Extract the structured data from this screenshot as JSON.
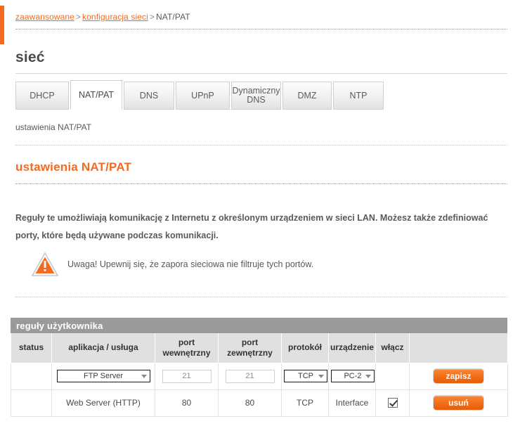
{
  "breadcrumb": {
    "item1": "zaawansowane",
    "sep1": ">",
    "item2": "konfiguracja sieci",
    "sep2": ">",
    "current": "NAT/PAT"
  },
  "page_title": "sieć",
  "tabs": [
    {
      "label": "DHCP",
      "active": false
    },
    {
      "label": "NAT/PAT",
      "active": true
    },
    {
      "label": "DNS",
      "active": false
    },
    {
      "label": "UPnP",
      "active": false
    },
    {
      "label": "Dynamiczny DNS",
      "active": false
    },
    {
      "label": "DMZ",
      "active": false
    },
    {
      "label": "NTP",
      "active": false
    }
  ],
  "sub_label": "ustawienia NAT/PAT",
  "section_heading": "ustawienia NAT/PAT",
  "description": "Reguły te umożliwiają komunikację z Internetu z określonym urządzeniem w sieci LAN. Możesz także zdefiniować porty, które będą używane podczas komunikacji.",
  "warning": {
    "icon": "warning-triangle-icon",
    "text": "Uwaga! Upewnij się, że zapora sieciowa nie filtruje tych portów."
  },
  "table": {
    "caption": "reguły użytkownika",
    "headers": {
      "status": "status",
      "app": "aplikacja / usługa",
      "port_internal": "port wewnętrzny",
      "port_external": "port zewnętrzny",
      "protocol": "protokół",
      "device": "urządzenie",
      "enable": "włącz",
      "action": ""
    },
    "form_row": {
      "status": "",
      "app_value": "FTP Server",
      "app_options": [
        "FTP Server"
      ],
      "port_internal_value": "21",
      "port_external_value": "21",
      "protocol_value": "TCP",
      "protocol_options": [
        "TCP"
      ],
      "device_value": "PC-2",
      "device_options": [
        "PC-2"
      ],
      "enable_checked": false,
      "action_label": "zapisz"
    },
    "data_rows": [
      {
        "status": "",
        "app": "Web Server (HTTP)",
        "port_internal": "80",
        "port_external": "80",
        "protocol": "TCP",
        "device": "Interface",
        "enable_checked": true,
        "action_label": "usuń"
      }
    ]
  },
  "colors": {
    "accent_orange": "#f36b21",
    "button_orange": "#f3701a",
    "caption_gray": "#9a9a9a",
    "header_gray": "#e0e0e0",
    "text_gray": "#58595b"
  }
}
